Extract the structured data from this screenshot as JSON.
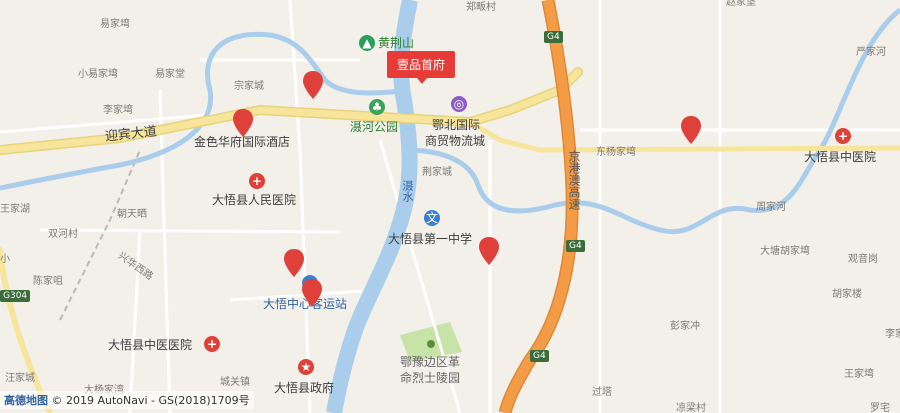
{
  "map": {
    "target_label": "壹品首府",
    "roads": {
      "yingbin": "迎宾大道",
      "xinghua_west": "兴华西路",
      "jinggang_ao_highway": "京港澳高速",
      "g4_badge": "G4",
      "g304_badge": "G304"
    },
    "water": {
      "huanshui": "滠水"
    },
    "places": [
      "易家塆",
      "小易家塆",
      "易家堂",
      "李家塆",
      "宗家城",
      "郑畈村",
      "荆家城",
      "陈家咀",
      "朝天晒",
      "双河村",
      "王家湖",
      "王家塆",
      "东杨家塆",
      "周家河",
      "大塘胡家塆",
      "观音岗",
      "胡家楼",
      "彭家冲",
      "严家河",
      "城关镇",
      "过塔",
      "凉梁村",
      "汪家城",
      "赵家堡",
      "大杨家湾",
      "小",
      "李家城",
      "罗宅"
    ],
    "pois": {
      "huangjing_mountain": "黄荆山",
      "huanhe_park": "滠河公园",
      "ebei_market_line1": "鄂北国际",
      "ebei_market_line2": "商贸物流城",
      "jinsehua_hotel": "金色华府国际酒店",
      "peoples_hospital": "大悟县人民医院",
      "tcm_hospital_east": "大悟县中医院",
      "first_middle_school": "大悟县第一中学",
      "bus_station": "大悟中心客运站",
      "tcm_hospital_west": "大悟县中医医院",
      "county_government": "大悟县政府",
      "martyrs_cemetery_line1": "鄂豫边区革",
      "martyrs_cemetery_line2": "命烈士陵园"
    },
    "credit": {
      "logo": "高德地图",
      "text": "© 2019 AutoNavi - GS(2018)1709号"
    },
    "colors": {
      "background": "#f3f0ea",
      "water": "#a9cdea",
      "highway": "#f39c45",
      "main_road": "#f7e59b",
      "park": "#c8e3a8",
      "pin_red": "#e0403a",
      "target_red": "#e63b36"
    }
  }
}
